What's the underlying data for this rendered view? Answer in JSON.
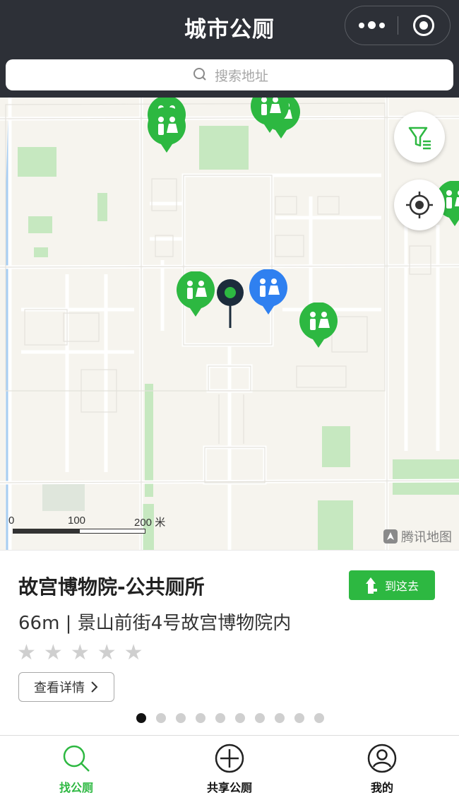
{
  "header": {
    "title": "城市公厕",
    "search_placeholder": "搜索地址"
  },
  "map": {
    "scale_labels": [
      "0",
      "100",
      "200 米"
    ],
    "brand": "腾讯地图",
    "colors": {
      "toilet_green": "#2db841",
      "toilet_blue": "#2f80f0",
      "pin": "#1c2c3c"
    }
  },
  "card": {
    "name": "故宫博物院-公共厕所",
    "navigate_label": "到这去",
    "address": "66m | 景山前街4号故宫博物院内",
    "rating": 0,
    "max_rating": 5,
    "detail_label": "查看详情",
    "page_count": 10,
    "current_page": 1
  },
  "tabbar": {
    "items": [
      {
        "label": "找公厕",
        "icon": "search-icon",
        "active": true
      },
      {
        "label": "共享公厕",
        "icon": "plus-circle-icon",
        "active": false
      },
      {
        "label": "我的",
        "icon": "user-icon",
        "active": false
      }
    ]
  }
}
